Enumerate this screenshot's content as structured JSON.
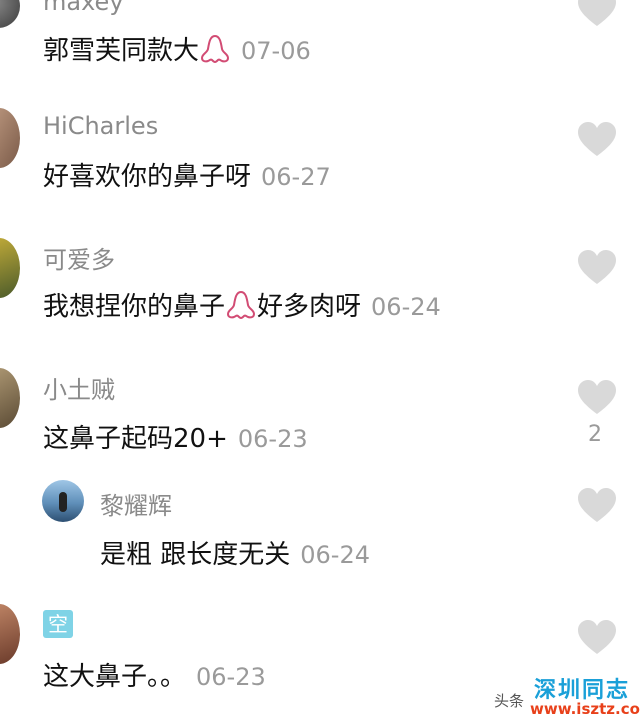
{
  "comments": [
    {
      "username": "maxey",
      "text": "郭雪芙同款大",
      "emoji": "nose",
      "date": "07-06"
    },
    {
      "username": "HiCharles",
      "text": "好喜欢你的鼻子呀",
      "date": "06-27"
    },
    {
      "username": "可爱多",
      "text_before": "我想捏你的鼻子",
      "emoji": "nose",
      "text_after": "好多肉呀",
      "date": "06-24"
    },
    {
      "username": "小土贼",
      "text": "这鼻子起码20+",
      "date": "06-23",
      "like_count": "2"
    },
    {
      "username": "黎耀辉",
      "text": "是粗 跟长度无关",
      "date": "06-24",
      "reply": true
    },
    {
      "username": "空",
      "text": "这大鼻子。。",
      "date": "06-23"
    }
  ],
  "watermark": {
    "small": "头条",
    "title": "深圳同志",
    "url": "www.isztz.com"
  },
  "colors": {
    "heart": "#d9d9d9",
    "nose_emoji": "#d24c74",
    "muted": "#8a8a8a"
  }
}
